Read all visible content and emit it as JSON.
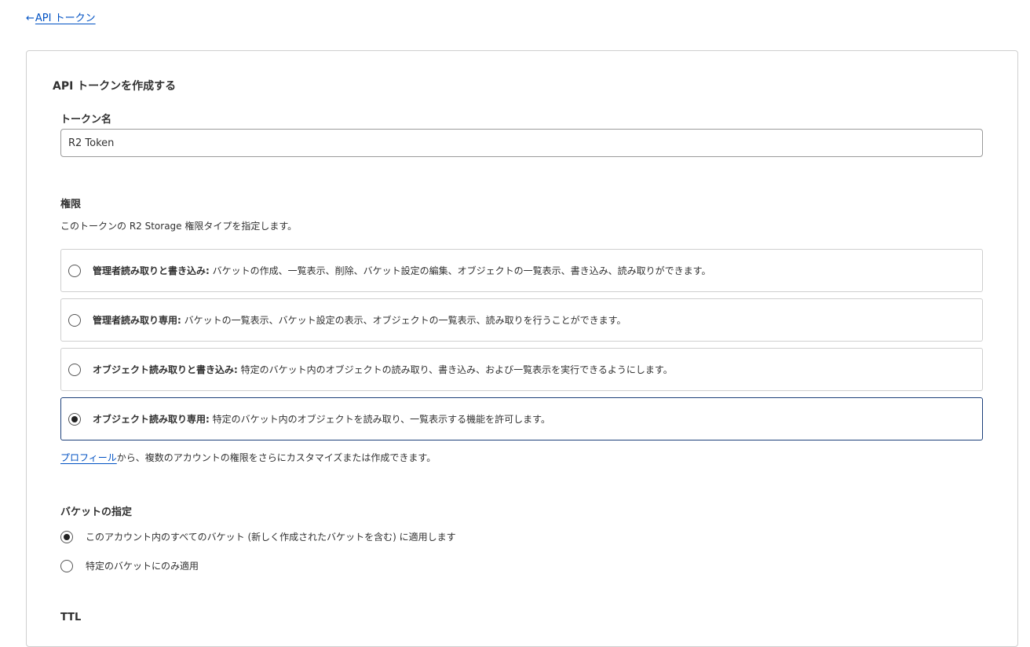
{
  "back_link": {
    "arrow": "←",
    "label": "API トークン"
  },
  "form": {
    "title": "API トークンを作成する",
    "token_name": {
      "label": "トークン名",
      "value": "R2 Token"
    },
    "permissions": {
      "label": "権限",
      "description": "このトークンの R2 Storage 権限タイプを指定します。",
      "options": [
        {
          "title": "管理者読み取りと書き込み:",
          "text": "バケットの作成、一覧表示、削除、バケット設定の編集、オブジェクトの一覧表示、書き込み、読み取りができます。",
          "selected": false
        },
        {
          "title": "管理者読み取り専用:",
          "text": "バケットの一覧表示、バケット設定の表示、オブジェクトの一覧表示、読み取りを行うことができます。",
          "selected": false
        },
        {
          "title": "オブジェクト読み取りと書き込み:",
          "text": "特定のバケット内のオブジェクトの読み取り、書き込み、および一覧表示を実行できるようにします。",
          "selected": false
        },
        {
          "title": "オブジェクト読み取り専用:",
          "text": "特定のバケット内のオブジェクトを読み取り、一覧表示する機能を許可します。",
          "selected": true
        }
      ],
      "profile_link": "プロフィール",
      "profile_note": "から、複数のアカウントの権限をさらにカスタマイズまたは作成できます。"
    },
    "bucket_scope": {
      "label": "バケットの指定",
      "options": [
        {
          "label": "このアカウント内のすべてのバケット (新しく作成されたバケットを含む) に適用します",
          "selected": true
        },
        {
          "label": "特定のバケットにのみ適用",
          "selected": false
        }
      ]
    },
    "ttl": {
      "label": "TTL"
    }
  },
  "colors": {
    "link": "#0051c3",
    "selected_border": "#1c3f7a",
    "border": "#cfcfcf"
  }
}
